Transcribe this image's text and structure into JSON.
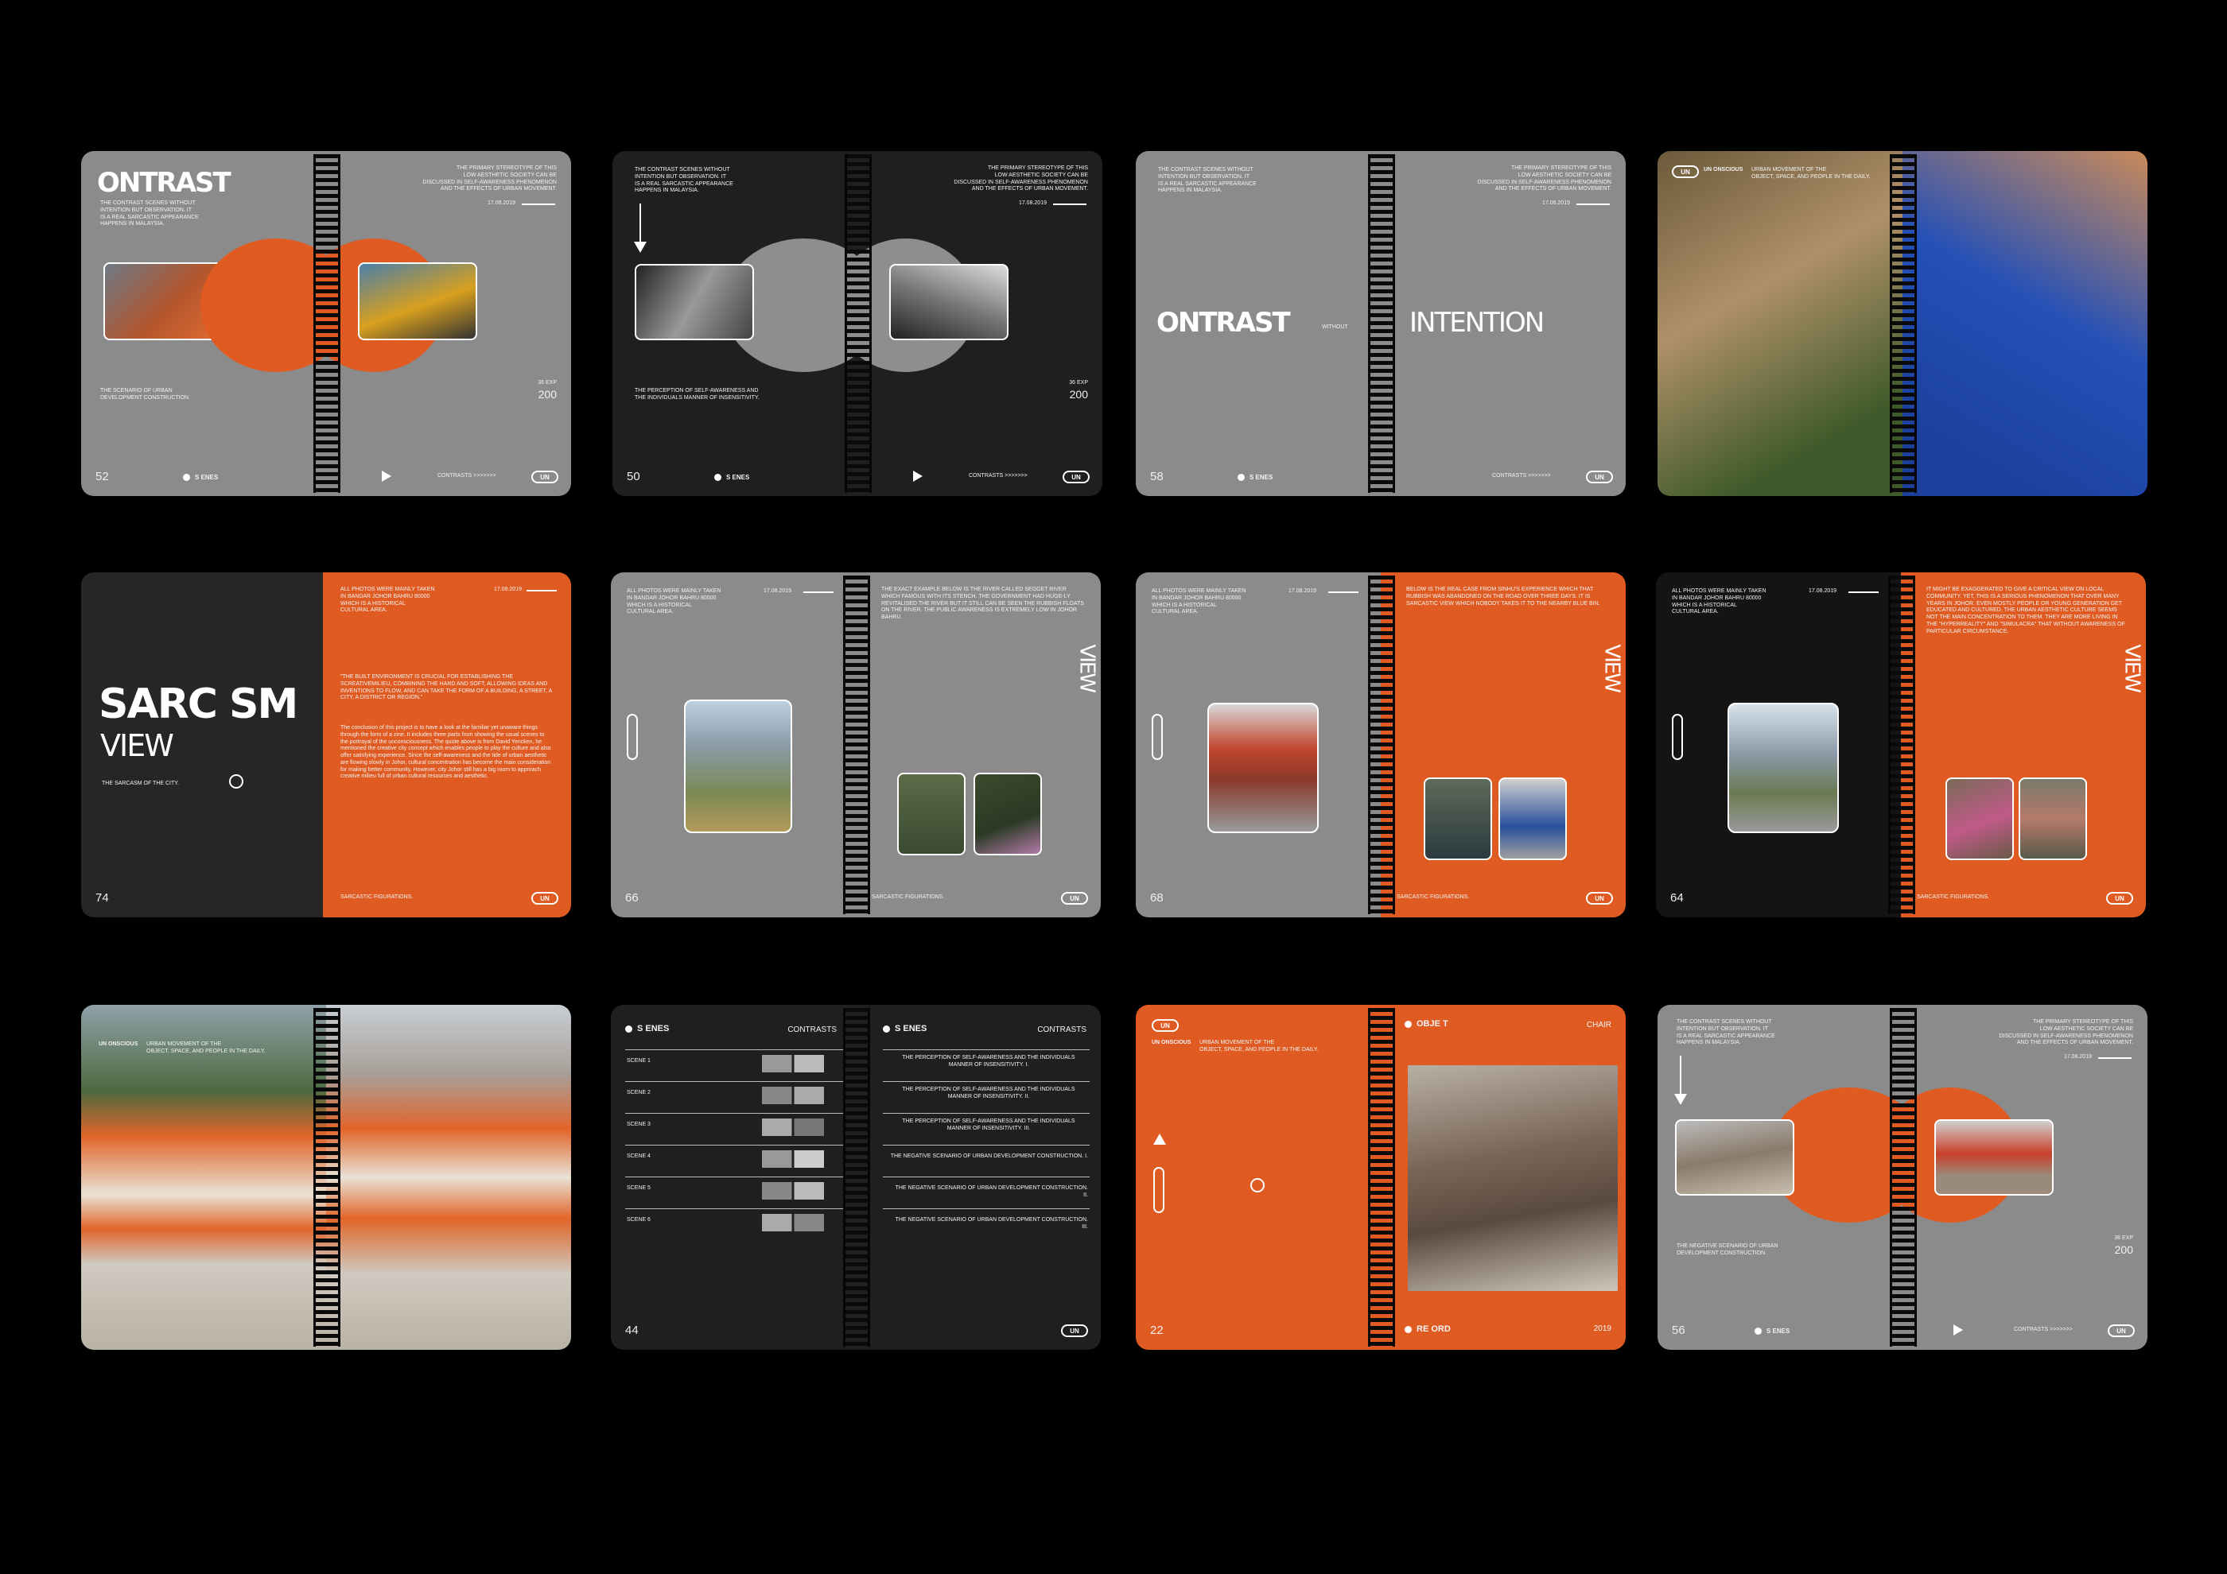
{
  "books": [
    {
      "page_left": "52",
      "title": "ONTRAST",
      "intro": "THE CONTRAST SCENES WITHOUT\nINTENTION BUT OBSERVATION. IT\nIS A REAL SARCASTIC APPEARANCE\nHAPPENS IN MALAYSIA.",
      "right_text": "THE PRIMARY STEREOTYPE OF THIS\nLOW AESTHETIC SOCIETY CAN BE\nDISCUSSED IN SELF-AWARENESS PHENOMENON\nAND THE EFFECTS OF URBAN MOVEMENT.",
      "date": "17.08.2019",
      "caption": "THE SCENARIO OF URBAN\nDEVELOPMENT CONSTRUCTION.",
      "exp": "36 EXP",
      "count": "200",
      "scenes": "S ENES",
      "contrasts": "CONTRASTS >>>>>>>",
      "logo": "UN"
    },
    {
      "page_left": "50",
      "intro": "THE CONTRAST SCENES WITHOUT\nINTENTION BUT OBSERVATION. IT\nIS A REAL SARCASTIC APPEARANCE\nHAPPENS IN MALAYSIA.",
      "right_text": "THE PRIMARY STEREOTYPE OF THIS\nLOW AESTHETIC SOCIETY CAN BE\nDISCUSSED IN SELF-AWARENESS PHENOMENON\nAND THE EFFECTS OF URBAN MOVEMENT.",
      "date": "17.08.2019",
      "caption": "THE PERCEPTION OF SELF-AWARENESS AND\nTHE INDIVIDUALS MANNER OF INSENSITIVITY.",
      "exp": "36 EXP",
      "count": "200",
      "scenes": "S ENES",
      "contrasts": "CONTRASTS >>>>>>>",
      "logo": "UN"
    },
    {
      "page_left": "58",
      "title_left": "ONTRAST",
      "without": "WITHOUT",
      "title_right": "INTENTION",
      "intro": "THE CONTRAST SCENES WITHOUT\nINTENTION BUT OBSERVATION. IT\nIS A REAL SARCASTIC APPEARANCE\nHAPPENS IN MALAYSIA.",
      "right_text": "THE PRIMARY STEREOTYPE OF THIS\nLOW AESTHETIC SOCIETY CAN BE\nDISCUSSED IN SELF-AWARENESS PHENOMENON\nAND THE EFFECTS OF URBAN MOVEMENT.",
      "date": "17.08.2019",
      "scenes": "S ENES",
      "contrasts": "CONTRASTS >>>>>>>",
      "logo": "UN"
    },
    {
      "logo": "UN",
      "head": "UN ONSCIOUS",
      "head_rest": "URBAN MOVEMENT OF THE\nOBJECT, SPACE, AND PEOPLE IN THE DAILY."
    },
    {
      "page_left": "74",
      "title1": "SARC SM",
      "title2": "VIEW",
      "subtitle": "THE SARCASM OF THE CITY.",
      "right_top": "ALL PHOTOS WERE MAINLY TAKEN\nIN BANDAR JOHOR BAHRU 80000\nWHICH IS A HISTORICAL\nCULTURAL AREA.",
      "date": "17.08.2019",
      "body1": "\"THE BUILT ENVIRONMENT IS CRUCIAL FOR ESTABLISHING THE SCREATIVEMILIEU, COMBINING THE HARD AND SOFT, ALLOWING IDEAS AND INVENTIONS TO FLOW, AND CAN TAKE THE FORM OF A BUILDING, A STREET, A CITY, A DISTRICT OR REGION.\"",
      "body2": "The conclusion of this project is to have a look at the familiar yet unaware things through the form of a zine. It includes three parts from showing the usual scenes to the portrayal of the unconsciousness. The quote above is from David Yencken, he mentioned the creative city concept which enables people to play the culture and also offer satisfying experience. Since the self-awareness and the tide of urban aesthetic are flowing slowly in Johor, cultural concentration has become the main consideration for making better community. However, city Johor still has a big room to approach creative milieu full of urban cultural resources and aesthetic.",
      "footer": "SARCASTIC FIGURATIONS.",
      "logo": "UN"
    },
    {
      "page_left": "66",
      "left_top": "ALL PHOTOS WERE MAINLY TAKEN\nIN BANDAR JOHOR BAHRU 80000\nWHICH IS A HISTORICAL\nCULTURAL AREA.",
      "date": "17.08.2019",
      "right_top": "THE EXACT EXAMPLE BELOW IS THE RIVER CALLED SEGGET RIVER WHICH FAMOUS WITH ITS STENCH. THE GOVERNMENT HAD HUGE-LY REVITALISED THE RIVER BUT IT STILL CAN BE SEEN THE RUBBISH FLOATS ON THE RIVER. THE PUBLIC AWARENESS IS EXTREMELY LOW IN JOHOR BAHRU.",
      "view": "VIEW",
      "footer": "SARCASTIC FIGURATIONS.",
      "logo": "UN"
    },
    {
      "page_left": "68",
      "left_top": "ALL PHOTOS WERE MAINLY TAKEN\nIN BANDAR JOHOR BAHRU 80000\nWHICH IS A HISTORICAL\nCULTURAL AREA.",
      "date": "17.08.2019",
      "right_top": "BELOW IS THE REAL CASE FROM SINHU'S EXPERIENCE WHICH THAT RUBBISH WAS ABANDONED ON THE ROAD OVER THREE DAYS. IT IS SARCASTIC VIEW WHICH NOBODY TAKES IT TO THE NEARBY BLUE BIN.",
      "view": "VIEW",
      "footer": "SARCASTIC FIGURATIONS.",
      "logo": "UN"
    },
    {
      "page_left": "64",
      "left_top": "ALL PHOTOS WERE MAINLY TAKEN\nIN BANDAR JOHOR BAHRU 80000\nWHICH IS A HISTORICAL\nCULTURAL AREA.",
      "date": "17.08.2019",
      "right_top": "IT MIGHT BE EXAGGERATED TO GIVE A CRITICAL VIEW ON LOCAL COMMUNITY. YET, THIS IS A SERIOUS PHENOMENON THAT OVER MANY YEARS IN JOHOR. EVEN MOSTLY PEOPLE OR YOUNG GENERATION GET EDUCATED AND CULTURED, THE URBAN AESTHETIC CULTURE SEEMS NOT THE MAIN CONCENTRATION TO THEM. THEY ARE MORE LIVING IN THE \"HYPERREALITY\" AND \"SIMULACRA\" THAT WITHOUT AWARENESS OF PARTICULAR CIRCUMSTANCE.",
      "view": "VIEW",
      "footer": "SARCASTIC FIGURATIONS.",
      "logo": "UN"
    },
    {
      "head": "UN ONSCIOUS",
      "head_rest": "URBAN MOVEMENT OF THE\nOBJECT, SPACE, AND PEOPLE IN THE DAILY."
    },
    {
      "page_left": "44",
      "scenes_left": "S ENES",
      "contrasts_left": "CONTRASTS",
      "scenes_right": "S ENES",
      "contrasts_right": "CONTRASTS",
      "rows": [
        {
          "label": "SCENE 1",
          "desc": "THE PERCEPTION OF SELF-AWARENESS AND THE INDIVIDUALS\nMANNER OF INSENSITIVITY.  I."
        },
        {
          "label": "SCENE 2",
          "desc": "THE PERCEPTION OF SELF-AWARENESS AND THE INDIVIDUALS\nMANNER OF INSENSITIVITY.  II."
        },
        {
          "label": "SCENE 3",
          "desc": "THE PERCEPTION OF SELF-AWARENESS AND THE INDIVIDUALS\nMANNER OF INSENSITIVITY.  III."
        },
        {
          "label": "SCENE 4",
          "desc": "THE NEGATIVE SCENARIO OF URBAN DEVELOPMENT CONSTRUCTION. I."
        },
        {
          "label": "SCENE 5",
          "desc": "THE NEGATIVE SCENARIO OF URBAN DEVELOPMENT CONSTRUCTION. II."
        },
        {
          "label": "SCENE 6",
          "desc": "THE NEGATIVE SCENARIO OF URBAN DEVELOPMENT CONSTRUCTION. III."
        }
      ],
      "logo": "UN"
    },
    {
      "page_left": "22",
      "logo": "UN",
      "head": "UN ONSCIOUS",
      "head_rest": "URBAN MOVEMENT OF THE\nOBJECT, SPACE, AND PEOPLE IN THE DAILY.",
      "object": "OBJE T",
      "chair": "CHAIR",
      "record": "RE ORD",
      "year": "2019"
    },
    {
      "page_left": "56",
      "intro": "THE CONTRAST SCENES WITHOUT\nINTENTION BUT OBSERVATION. IT\nIS A REAL SARCASTIC APPEARANCE\nHAPPENS IN MALAYSIA.",
      "right_text": "THE PRIMARY STEREOTYPE OF THIS\nLOW AESTHETIC SOCIETY CAN BE\nDISCUSSED IN SELF-AWARENESS PHENOMENON\nAND THE EFFECTS OF URBAN MOVEMENT.",
      "date": "17.08.2019",
      "caption": "THE NEGATIVE SCENARIO OF URBAN\nDEVELOPMENT CONSTRUCTION.",
      "exp": "36 EXP",
      "count": "200",
      "scenes": "S ENES",
      "contrasts": "CONTRASTS >>>>>>>",
      "logo": "UN"
    }
  ],
  "colors": {
    "background": "#000000",
    "gray_page": "#8b8b8b",
    "dark_page": "#1f1f1f",
    "orange_page": "#e05b22"
  }
}
